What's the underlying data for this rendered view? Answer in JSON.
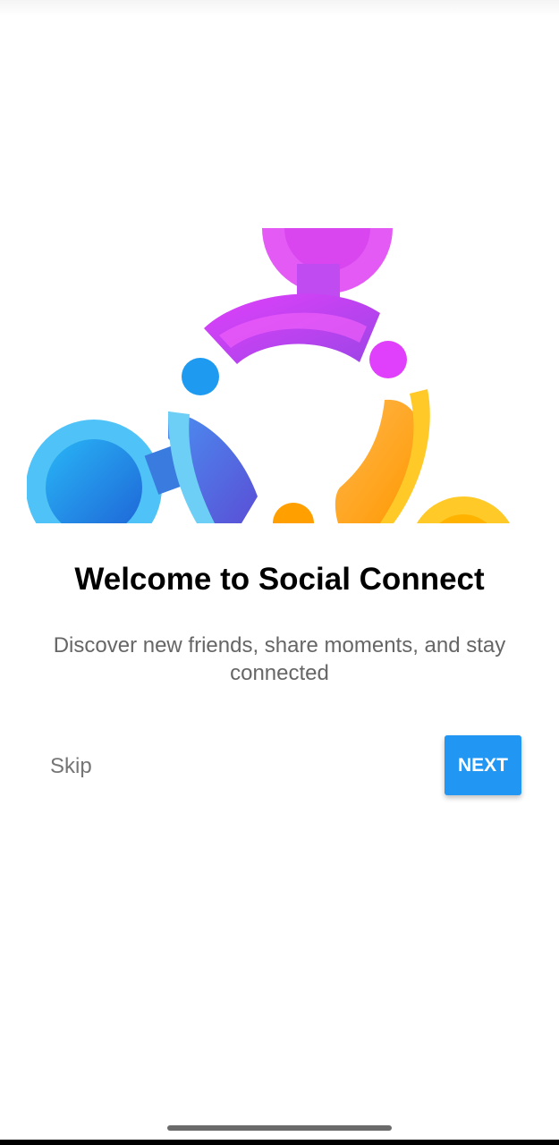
{
  "onboarding": {
    "title": "Welcome to Social Connect",
    "subtitle": "Discover new friends, share moments, and stay connected",
    "skip_label": "Skip",
    "next_label": "NEXT"
  },
  "illustration": {
    "icon": "social-connect-logo-icon",
    "colors": {
      "magenta": "#e040fb",
      "purple": "#a545e8",
      "blue": "#1e88e5",
      "light_blue": "#4fc3f7",
      "orange": "#ffa726",
      "yellow": "#ffca28"
    }
  },
  "colors": {
    "accent": "#2196f3",
    "title": "#000000",
    "subtitle": "#666666",
    "skip": "#757575"
  }
}
